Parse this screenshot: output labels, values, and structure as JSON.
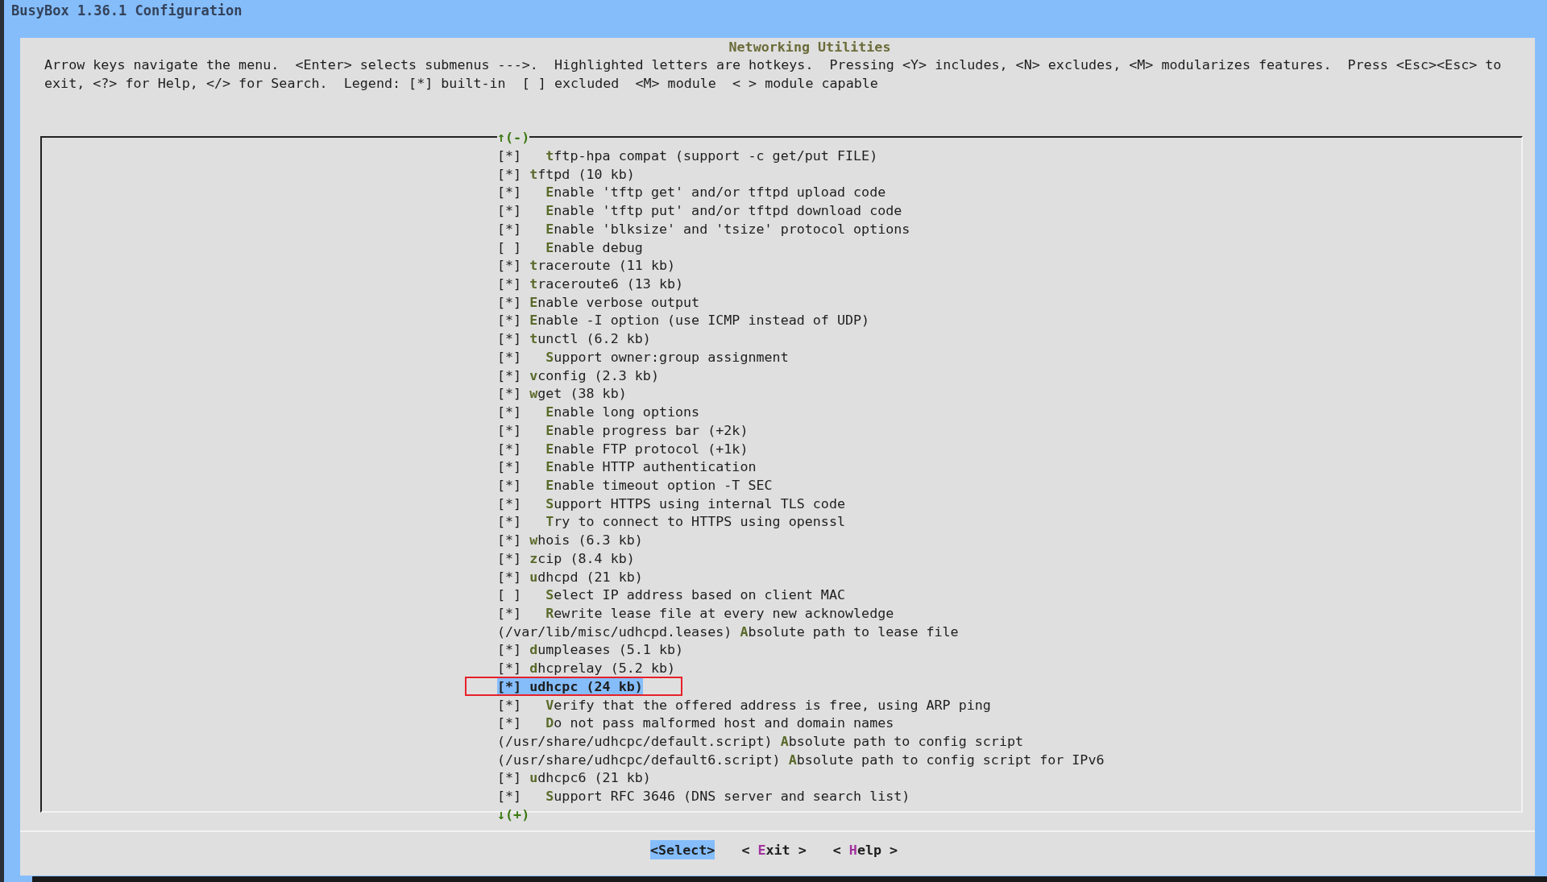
{
  "window": {
    "title": "BusyBox 1.36.1 Configuration"
  },
  "dialog": {
    "title": "Networking Utilities",
    "help": "Arrow keys navigate the menu.  <Enter> selects submenus --->.  Highlighted letters are hotkeys.  Pressing <Y> includes, <N> excludes, <M> modularizes features.  Press <Esc><Esc> to exit, <?> for Help, </> for Search.  Legend: [*] built-in  [ ] excluded  <M> module  < > module capable",
    "scroll_up_indicator": "↑(-)",
    "scroll_down_indicator": "↓(+)",
    "items": [
      {
        "kind": "sub-option",
        "box": "[*]",
        "label": "tftp-hpa compat (support -c get/put FILE)",
        "selected": false
      },
      {
        "kind": "option",
        "box": "[*]",
        "label": "tftpd (10 kb)",
        "selected": false
      },
      {
        "kind": "sub-option",
        "box": "[*]",
        "label": "Enable 'tftp get' and/or tftpd upload code",
        "selected": false
      },
      {
        "kind": "sub-option",
        "box": "[*]",
        "label": "Enable 'tftp put' and/or tftpd download code",
        "selected": false
      },
      {
        "kind": "sub-option",
        "box": "[*]",
        "label": "Enable 'blksize' and 'tsize' protocol options",
        "selected": false
      },
      {
        "kind": "sub-option",
        "box": "[ ]",
        "label": "Enable debug",
        "selected": false
      },
      {
        "kind": "option",
        "box": "[*]",
        "label": "traceroute (11 kb)",
        "selected": false
      },
      {
        "kind": "option",
        "box": "[*]",
        "label": "traceroute6 (13 kb)",
        "selected": false
      },
      {
        "kind": "option",
        "box": "[*]",
        "label": "Enable verbose output",
        "selected": false
      },
      {
        "kind": "option",
        "box": "[*]",
        "label": "Enable -I option (use ICMP instead of UDP)",
        "selected": false
      },
      {
        "kind": "option",
        "box": "[*]",
        "label": "tunctl (6.2 kb)",
        "selected": false
      },
      {
        "kind": "sub-option",
        "box": "[*]",
        "label": "Support owner:group assignment",
        "selected": false
      },
      {
        "kind": "option",
        "box": "[*]",
        "label": "vconfig (2.3 kb)",
        "selected": false
      },
      {
        "kind": "option",
        "box": "[*]",
        "label": "wget (38 kb)",
        "selected": false
      },
      {
        "kind": "sub-option",
        "box": "[*]",
        "label": "Enable long options",
        "selected": false
      },
      {
        "kind": "sub-option",
        "box": "[*]",
        "label": "Enable progress bar (+2k)",
        "selected": false
      },
      {
        "kind": "sub-option",
        "box": "[*]",
        "label": "Enable FTP protocol (+1k)",
        "selected": false
      },
      {
        "kind": "sub-option",
        "box": "[*]",
        "label": "Enable HTTP authentication",
        "selected": false
      },
      {
        "kind": "sub-option",
        "box": "[*]",
        "label": "Enable timeout option -T SEC",
        "selected": false
      },
      {
        "kind": "sub-option",
        "box": "[*]",
        "label": "Support HTTPS using internal TLS code",
        "selected": false
      },
      {
        "kind": "sub-option",
        "box": "[*]",
        "label": "Try to connect to HTTPS using openssl",
        "selected": false
      },
      {
        "kind": "option",
        "box": "[*]",
        "label": "whois (6.3 kb)",
        "selected": false
      },
      {
        "kind": "option",
        "box": "[*]",
        "label": "zcip (8.4 kb)",
        "selected": false
      },
      {
        "kind": "option",
        "box": "[*]",
        "label": "udhcpd (21 kb)",
        "selected": false
      },
      {
        "kind": "sub-option",
        "box": "[ ]",
        "label": "Select IP address based on client MAC",
        "selected": false
      },
      {
        "kind": "sub-option",
        "box": "[*]",
        "label": "Rewrite lease file at every new acknowledge",
        "selected": false
      },
      {
        "kind": "path",
        "path": "(/var/lib/misc/udhcpd.leases)",
        "label": "Absolute path to lease file",
        "selected": false
      },
      {
        "kind": "option",
        "box": "[*]",
        "label": "dumpleases (5.1 kb)",
        "selected": false
      },
      {
        "kind": "option",
        "box": "[*]",
        "label": "dhcprelay (5.2 kb)",
        "selected": false
      },
      {
        "kind": "option",
        "box": "[*]",
        "label": "udhcpc (24 kb)",
        "selected": true,
        "annotated": true
      },
      {
        "kind": "sub-option",
        "box": "[*]",
        "label": "Verify that the offered address is free, using ARP ping",
        "selected": false
      },
      {
        "kind": "sub-option",
        "box": "[*]",
        "label": "Do not pass malformed host and domain names",
        "selected": false
      },
      {
        "kind": "path",
        "path": "(/usr/share/udhcpc/default.script)",
        "label": "Absolute path to config script",
        "selected": false
      },
      {
        "kind": "path",
        "path": "(/usr/share/udhcpc/default6.script)",
        "label": "Absolute path to config script for IPv6",
        "selected": false
      },
      {
        "kind": "option",
        "box": "[*]",
        "label": "udhcpc6 (21 kb)",
        "selected": false
      },
      {
        "kind": "sub-option",
        "box": "[*]",
        "label": "Support RFC 3646 (DNS server and search list)",
        "selected": false
      }
    ],
    "buttons": [
      {
        "label": "<Select>",
        "selected": true
      },
      {
        "label": "< Exit >",
        "selected": false
      },
      {
        "label": "< Help >",
        "selected": false
      }
    ]
  }
}
